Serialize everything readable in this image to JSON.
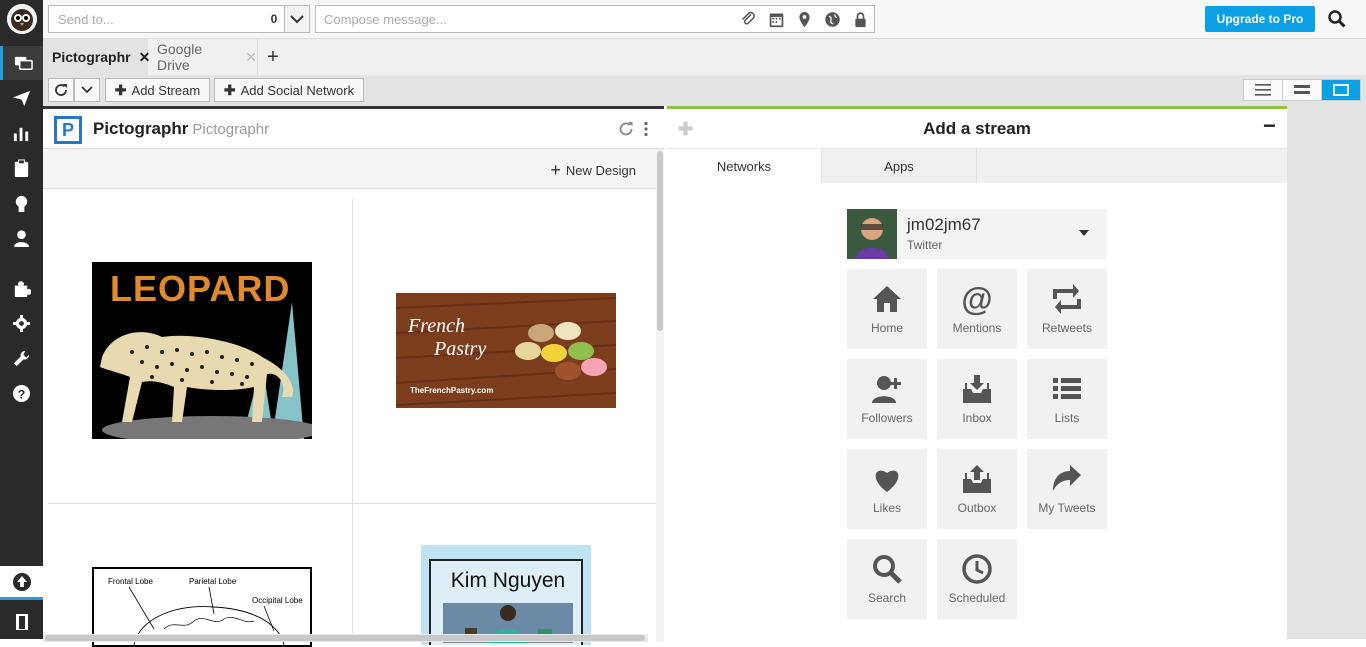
{
  "topbar": {
    "send_to_placeholder": "Send to...",
    "send_to_count": "0",
    "compose_placeholder": "Compose message...",
    "upgrade_label": "Upgrade to Pro"
  },
  "tabs": [
    {
      "label": "Pictographr"
    },
    {
      "label": "Google Drive"
    }
  ],
  "toolbar": {
    "add_stream_label": "Add Stream",
    "add_social_label": "Add Social Network"
  },
  "stream": {
    "title": "Pictographr",
    "subtitle": "Pictographr",
    "new_design_label": "New Design",
    "thumbs": {
      "leopard_text": "LEOPARD",
      "pastry_title_1": "French",
      "pastry_title_2": "Pastry",
      "pastry_site": "TheFrenchPastry.com",
      "brain_label_1": "Frontal Lobe",
      "brain_label_2": "Parietal Lobe",
      "brain_label_3": "Occipital Lobe",
      "kim_name": "Kim Nguyen"
    }
  },
  "addstream": {
    "title": "Add a stream",
    "tab_networks": "Networks",
    "tab_apps": "Apps",
    "account_name": "jm02jm67",
    "account_network": "Twitter",
    "buttons": [
      {
        "label": "Home",
        "icon": "home-icon"
      },
      {
        "label": "Mentions",
        "icon": "at-icon"
      },
      {
        "label": "Retweets",
        "icon": "retweet-icon"
      },
      {
        "label": "Followers",
        "icon": "add-user-icon"
      },
      {
        "label": "Inbox",
        "icon": "inbox-icon"
      },
      {
        "label": "Lists",
        "icon": "list-icon"
      },
      {
        "label": "Likes",
        "icon": "heart-icon"
      },
      {
        "label": "Outbox",
        "icon": "outbox-icon"
      },
      {
        "label": "My Tweets",
        "icon": "share-arrow-icon"
      },
      {
        "label": "Search",
        "icon": "search-icon"
      },
      {
        "label": "Scheduled",
        "icon": "clock-icon"
      }
    ]
  },
  "colors": {
    "accent_blue": "#0b9fe6",
    "nav_dark": "#2a2a2a",
    "add_pane_accent": "#8cc63f"
  }
}
